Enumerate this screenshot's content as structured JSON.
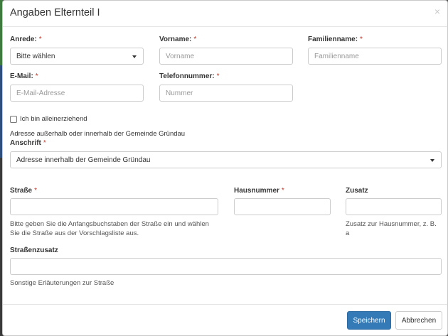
{
  "modal": {
    "title": "Angaben Elternteil I",
    "close_glyph": "×"
  },
  "required_marker": "*",
  "anrede": {
    "label": "Anrede:",
    "value": "Bitte wählen"
  },
  "vorname": {
    "label": "Vorname:",
    "placeholder": "Vorname"
  },
  "familienname": {
    "label": "Familienname:",
    "placeholder": "Familienname"
  },
  "email": {
    "label": "E-Mail:",
    "placeholder": "E-Mail-Adresse"
  },
  "telefon": {
    "label": "Telefonnummer:",
    "placeholder": "Nummer"
  },
  "alleinerziehend": {
    "label": "Ich bin alleinerziehend",
    "checked": false
  },
  "adresse_hint": "Adresse außerhalb oder innerhalb der Gemeinde Gründau",
  "anschrift": {
    "label": "Anschrift",
    "value": "Adresse innerhalb der Gemeinde Gründau"
  },
  "strasse": {
    "label": "Straße",
    "help_line1": "Bitte geben Sie die Anfangsbuchstaben der Straße ein und wählen",
    "help_line2": "Sie die Straße aus der Vorschlagsliste aus."
  },
  "hausnummer": {
    "label": "Hausnummer"
  },
  "zusatz": {
    "label": "Zusatz",
    "help_line1": "Zusatz zur Hausnummer, z. B.",
    "help_line2": "a"
  },
  "strassenzusatz": {
    "label": "Straßenzusatz",
    "help": "Sonstige Erläuterungen zur Straße"
  },
  "footer": {
    "save_label": "Speichern",
    "cancel_label": "Abbrechen"
  },
  "colors": {
    "primary": "#337ab7",
    "required": "#c0392b"
  },
  "icons": {
    "dropdown": "caret-down-icon",
    "close": "close-icon"
  }
}
